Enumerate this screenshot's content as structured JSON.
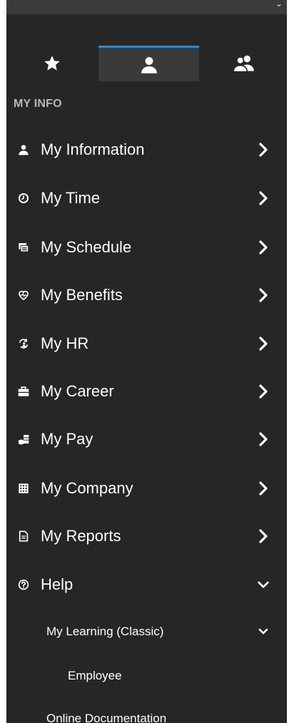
{
  "tabs": {
    "favorites": {
      "icon": "star-icon"
    },
    "my_info": {
      "icon": "person-icon",
      "active": true
    },
    "team": {
      "icon": "people-icon"
    }
  },
  "section_title": "MY INFO",
  "menu": [
    {
      "label": "My Information",
      "icon": "person-icon",
      "state": "collapsed"
    },
    {
      "label": "My Time",
      "icon": "clock-icon",
      "state": "collapsed"
    },
    {
      "label": "My Schedule",
      "icon": "calendar-icon",
      "state": "collapsed"
    },
    {
      "label": "My Benefits",
      "icon": "heart-pulse-icon",
      "state": "collapsed"
    },
    {
      "label": "My HR",
      "icon": "sync-person-icon",
      "state": "collapsed"
    },
    {
      "label": "My Career",
      "icon": "briefcase-icon",
      "state": "collapsed"
    },
    {
      "label": "My Pay",
      "icon": "money-icon",
      "state": "collapsed"
    },
    {
      "label": "My Company",
      "icon": "building-icon",
      "state": "collapsed"
    },
    {
      "label": "My Reports",
      "icon": "report-icon",
      "state": "collapsed"
    },
    {
      "label": "Help",
      "icon": "help-icon",
      "state": "expanded"
    }
  ],
  "help_children": [
    {
      "label": "My Learning (Classic)",
      "state": "expanded"
    },
    {
      "label": "Employee"
    },
    {
      "label": "Online Documentation"
    }
  ],
  "colors": {
    "panel_bg": "#262626",
    "active_tab_bg": "#3a3a3a",
    "active_tab_accent": "#1b8fe0",
    "section_label": "#b9b9b9"
  }
}
